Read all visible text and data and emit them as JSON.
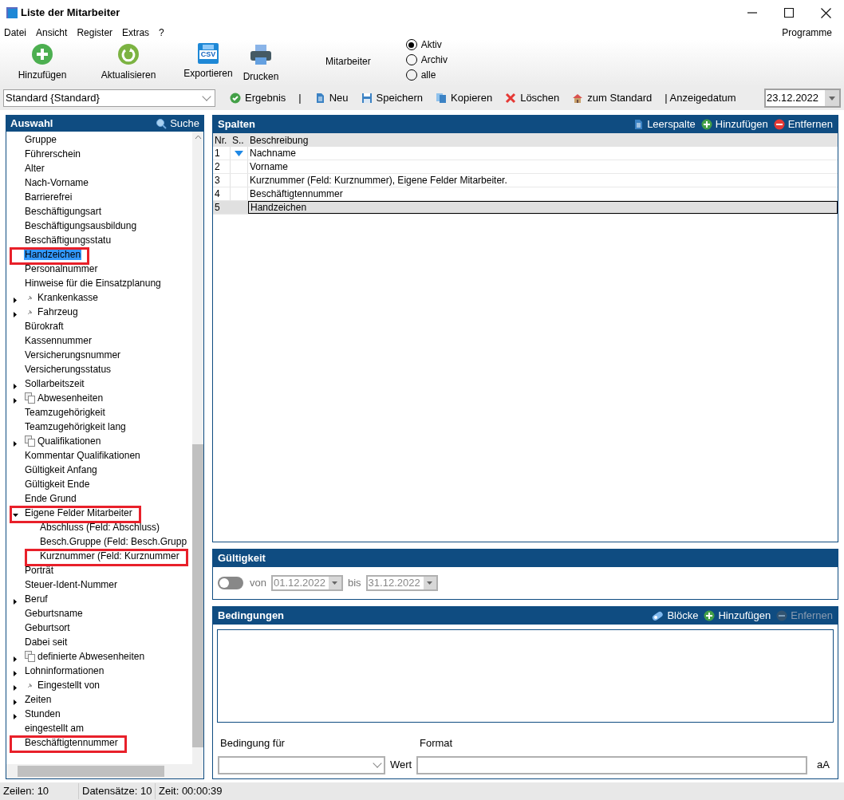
{
  "window": {
    "title": "Liste der Mitarbeiter"
  },
  "menu": [
    "Datei",
    "Ansicht",
    "Register",
    "Extras",
    "?"
  ],
  "menu_right": "Programme",
  "toolbar": [
    {
      "label": "Hinzufügen",
      "kind": "add"
    },
    {
      "label": "Aktualisieren",
      "kind": "refresh"
    },
    {
      "label": "Exportieren",
      "kind": "csv",
      "icon_text": "CSV"
    },
    {
      "label": "Drucken",
      "kind": "print"
    }
  ],
  "filter": {
    "label": "Mitarbeiter",
    "options": [
      {
        "label": "Aktiv",
        "selected": true
      },
      {
        "label": "Archiv",
        "selected": false
      },
      {
        "label": "alle",
        "selected": false
      }
    ]
  },
  "layout_select": "Standard {Standard}",
  "actions": [
    {
      "kind": "check",
      "label": "Ergebnis"
    },
    {
      "kind": "text",
      "label": "|"
    },
    {
      "kind": "doc",
      "label": "Neu"
    },
    {
      "kind": "save",
      "label": "Speichern"
    },
    {
      "kind": "copy",
      "label": "Kopieren"
    },
    {
      "kind": "delete",
      "label": "Löschen"
    },
    {
      "kind": "home",
      "label": "zum Standard"
    },
    {
      "kind": "text",
      "label": "| Anzeigedatum"
    }
  ],
  "display_date": "23.12.2022",
  "sidebar": {
    "title": "Auswahl",
    "search": "Suche",
    "items": [
      {
        "label": "Gruppe"
      },
      {
        "label": "Führerschein"
      },
      {
        "label": "Alter"
      },
      {
        "label": "Nach-Vorname"
      },
      {
        "label": "Barrierefrei"
      },
      {
        "label": "Beschäftigungsart"
      },
      {
        "label": "Beschäftigungsausbildung"
      },
      {
        "label": "Beschäftigungsstatu"
      },
      {
        "label": "Handzeichen",
        "selected": true,
        "marked": true
      },
      {
        "label": "Personalnummer"
      },
      {
        "label": "Hinweise für die Einsatzplanung"
      },
      {
        "label": "Krankenkasse",
        "expanded": false,
        "kind": "pin"
      },
      {
        "label": "Fahrzeug",
        "expanded": false,
        "kind": "pin"
      },
      {
        "label": "Bürokraft"
      },
      {
        "label": "Kassennummer"
      },
      {
        "label": "Versicherungsnummer"
      },
      {
        "label": "Versicherungsstatus"
      },
      {
        "label": "Sollarbeitszeit",
        "expanded": false
      },
      {
        "label": "Abwesenheiten",
        "expanded": false,
        "kind": "pages"
      },
      {
        "label": "Teamzugehörigkeit"
      },
      {
        "label": "Teamzugehörigkeit lang"
      },
      {
        "label": "Qualifikationen",
        "expanded": false,
        "kind": "pages"
      },
      {
        "label": "Kommentar Qualifikationen"
      },
      {
        "label": "Gültigkeit Anfang"
      },
      {
        "label": "Gültigkeit Ende"
      },
      {
        "label": "Ende Grund"
      },
      {
        "label": "Eigene Felder Mitarbeiter",
        "expanded": true,
        "marked": true,
        "children": [
          {
            "label": "Abschluss (Feld: Abschluss)"
          },
          {
            "label": "Besch.Gruppe (Feld: Besch.Grupp"
          },
          {
            "label": "Kurznummer (Feld: Kurznummer",
            "marked": true
          }
        ]
      },
      {
        "label": "Porträt"
      },
      {
        "label": "Steuer-Ident-Nummer"
      },
      {
        "label": "Beruf",
        "expanded": false
      },
      {
        "label": "Geburtsname"
      },
      {
        "label": "Geburtsort"
      },
      {
        "label": "Dabei seit"
      },
      {
        "label": "definierte Abwesenheiten",
        "expanded": false,
        "kind": "pages"
      },
      {
        "label": "Lohninformationen",
        "expanded": false
      },
      {
        "label": "Eingestellt von",
        "expanded": false,
        "kind": "pin"
      },
      {
        "label": "Zeiten",
        "expanded": false
      },
      {
        "label": "Stunden",
        "expanded": false
      },
      {
        "label": "eingestellt am"
      },
      {
        "label": "Beschäftigtennummer",
        "marked": true
      }
    ]
  },
  "columns_panel": {
    "title": "Spalten",
    "actions": [
      {
        "label": "Leerspalte",
        "kind": "doc"
      },
      {
        "label": "Hinzufügen",
        "kind": "plus"
      },
      {
        "label": "Entfernen",
        "kind": "minus"
      }
    ],
    "table": {
      "columns": [
        "Nr.",
        "S..",
        "Beschreibung"
      ],
      "rows": [
        {
          "nr": "1",
          "sorted": true,
          "text": "Nachname",
          "selected": false
        },
        {
          "nr": "2",
          "sorted": false,
          "text": "Vorname",
          "selected": false
        },
        {
          "nr": "3",
          "sorted": false,
          "text": "Kurznummer (Feld: Kurznummer), Eigene Felder Mitarbeiter.",
          "selected": false
        },
        {
          "nr": "4",
          "sorted": false,
          "text": "Beschäftigtennummer",
          "selected": false
        },
        {
          "nr": "5",
          "sorted": false,
          "text": "Handzeichen",
          "selected": true
        }
      ]
    }
  },
  "validity": {
    "title": "Gültigkeit",
    "on": false,
    "from_label": "von",
    "from": "01.12.2022",
    "to_label": "bis",
    "to": "31.12.2022"
  },
  "conditions": {
    "title": "Bedingungen",
    "actions": [
      {
        "label": "Blöcke",
        "kind": "blocks",
        "disabled": false
      },
      {
        "label": "Hinzufügen",
        "kind": "plus",
        "disabled": false
      },
      {
        "label": "Enfernen",
        "kind": "minus",
        "disabled": true
      }
    ],
    "condition_for_label": "Bedingung für",
    "format_label": "Format",
    "value_label": "Wert",
    "case_label": "aA"
  },
  "status_bar": [
    "Zeilen: 10",
    "Datensätze: 10",
    "Zeit: 00:00:39"
  ]
}
